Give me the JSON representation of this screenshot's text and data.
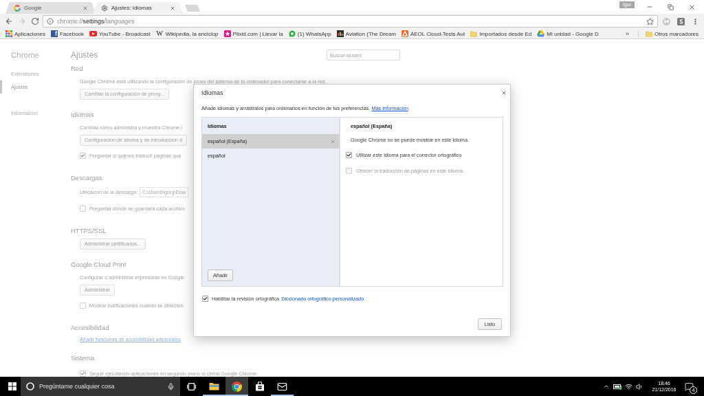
{
  "window": {
    "profile": "Igor"
  },
  "tabs": [
    {
      "title": "Google",
      "kind": "search",
      "selected": false
    },
    {
      "title": "Ajustes: Idiomas",
      "kind": "settings",
      "selected": true
    }
  ],
  "toolbar": {
    "navigation": [
      {
        "kind": "back",
        "disabled": false
      },
      {
        "kind": "forward",
        "disabled": true
      },
      {
        "kind": "reload",
        "disabled": false
      }
    ],
    "address": {
      "prefix": "chrome://",
      "host": "settings",
      "suffix": "/languages"
    }
  },
  "bookmarks": {
    "items": [
      {
        "label": "Aplicaciones",
        "kind": "apps"
      },
      {
        "label": "Facebook",
        "kind": "letter",
        "glyph": "f"
      },
      {
        "label": "YouTube - Broadcast",
        "kind": "video"
      },
      {
        "label": "Wikipedia, la enciclop",
        "kind": "wiki",
        "glyph": "W"
      },
      {
        "label": "Plixid.com | Llevar la",
        "kind": "star"
      },
      {
        "label": "(1) WhatsApp",
        "kind": "chat"
      },
      {
        "label": "Aviation (The Dream",
        "kind": "bars"
      },
      {
        "label": "AEOL Cloud-Tests Aut",
        "kind": "triangle"
      },
      {
        "label": "Importados desde Ed",
        "kind": "folder"
      },
      {
        "label": "Mi unidad - Google D",
        "kind": "drive"
      }
    ],
    "overflow": "»",
    "other": "Otros marcadores"
  },
  "settings_nav": {
    "title": "Chrome",
    "items": [
      {
        "label": "Extensiones",
        "selected": false
      },
      {
        "label": "Ajustes",
        "selected": true
      }
    ],
    "extra_items": [
      {
        "label": "Información",
        "selected": false
      }
    ]
  },
  "settings": {
    "title": "Ajustes",
    "search": {
      "placeholder": "Buscar ajustes"
    },
    "sections": [
      {
        "title": "Red",
        "items": [
          {
            "kind": "text",
            "text": "Google Chrome está utilizando la configuración de proxy del sistema de tu ordenador para conectarse a la red."
          },
          {
            "kind": "button",
            "label": "Cambiar la configuración de proxy..."
          }
        ]
      },
      {
        "title": "Idiomas",
        "items": [
          {
            "kind": "text",
            "text": "Cambiar cómo administra y muestra Chrome l"
          },
          {
            "kind": "button",
            "label": "Configuración de idioma y de introducción d"
          },
          {
            "kind": "checkbox",
            "label": "Preguntar si quieres traducir páginas que",
            "checked": true
          }
        ]
      },
      {
        "title": "Descargas",
        "items": [
          {
            "kind": "field",
            "label": "Ubicación de la descarga:",
            "value": "C:\\Users\\igorg\\Dow"
          },
          {
            "kind": "checkbox",
            "label": "Preguntar dónde se guardará cada archivo",
            "checked": false
          }
        ]
      },
      {
        "title": "HTTPS/SSL",
        "items": [
          {
            "kind": "button",
            "label": "Administrar certificados..."
          }
        ]
      },
      {
        "title": "Google Cloud Print",
        "items": [
          {
            "kind": "text",
            "text": "Configurar o administrar impresoras en Google"
          },
          {
            "kind": "button",
            "label": "Administrar"
          },
          {
            "kind": "checkbox",
            "label": "Mostrar notificaciones cuando se detecten",
            "checked": false
          }
        ]
      },
      {
        "title": "Accesibilidad",
        "items": [
          {
            "kind": "link",
            "text": "Añadir funciones de accesibilidad adicionales"
          }
        ]
      },
      {
        "title": "Sistema",
        "items": [
          {
            "kind": "checkbox",
            "label": "Seguir ejecutando aplicaciones en segundo plano al cerrar Google Chrome",
            "checked": true
          }
        ]
      }
    ]
  },
  "dialog": {
    "title": "Idiomas",
    "description": "Añade idiomas y arrástralos para ordenarlos en función de tus preferencias.",
    "description_link": "Más información",
    "list": {
      "header": "Idiomas",
      "items": [
        {
          "label": "español (España)",
          "selected": true
        },
        {
          "label": "español",
          "selected": false
        }
      ],
      "add_button": "Añadir"
    },
    "details": {
      "title": "español (España)",
      "note": "Google Chrome no se puede mostrar en este idioma.",
      "options": [
        {
          "label": "Utilizar este idioma para el corrector ortográfico",
          "checked": true,
          "disabled": false
        },
        {
          "label": "Ofrecer la traducción de páginas en este idioma",
          "checked": false,
          "disabled": true
        }
      ]
    },
    "spellcheck": {
      "label": "Habilitar la revisión ortográfica",
      "checked": true,
      "link": "Diccionario ortográfico personalizado"
    },
    "done_button": "Listo"
  },
  "taskbar": {
    "search": {
      "placeholder": "Pregúntame cualquier cosa"
    },
    "apps": [
      {
        "kind": "explorer",
        "running": true,
        "active": false
      },
      {
        "kind": "browser",
        "running": true,
        "active": true
      },
      {
        "kind": "store",
        "running": false,
        "active": false
      },
      {
        "kind": "mail",
        "running": true,
        "active": false
      }
    ],
    "time": "18:46",
    "date": "21/12/2016",
    "notifications": "4"
  }
}
